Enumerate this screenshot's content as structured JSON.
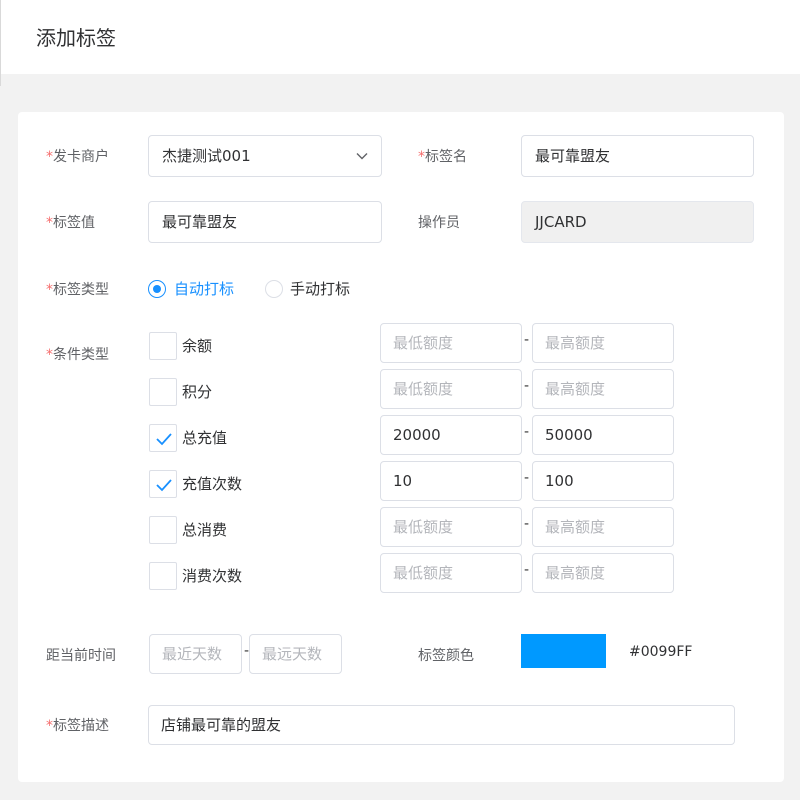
{
  "header": {
    "title": "添加标签"
  },
  "form": {
    "required_mark": "*",
    "merchant": {
      "label": "发卡商户",
      "value": "杰捷测试001"
    },
    "tag_name": {
      "label": "标签名",
      "value": "最可靠盟友"
    },
    "tag_value": {
      "label": "标签值",
      "value": "最可靠盟友"
    },
    "operator": {
      "label": "操作员",
      "value": "JJCARD"
    },
    "tag_type": {
      "label": "标签类型",
      "options": [
        {
          "label": "自动打标",
          "selected": true
        },
        {
          "label": "手动打标",
          "selected": false
        }
      ]
    },
    "conditions": {
      "label": "条件类型",
      "separator": "-",
      "items": [
        {
          "label": "余额",
          "checked": false,
          "min": "",
          "max": "",
          "min_placeholder": "最低额度",
          "max_placeholder": "最高额度"
        },
        {
          "label": "积分",
          "checked": false,
          "min": "",
          "max": "",
          "min_placeholder": "最低额度",
          "max_placeholder": "最高额度"
        },
        {
          "label": "总充值",
          "checked": true,
          "min": "20000",
          "max": "50000",
          "min_placeholder": "最低额度",
          "max_placeholder": "最高额度"
        },
        {
          "label": "充值次数",
          "checked": true,
          "min": "10",
          "max": "100",
          "min_placeholder": "最低额度",
          "max_placeholder": "最高额度"
        },
        {
          "label": "总消费",
          "checked": false,
          "min": "",
          "max": "",
          "min_placeholder": "最低额度",
          "max_placeholder": "最高额度"
        },
        {
          "label": "消费次数",
          "checked": false,
          "min": "",
          "max": "",
          "min_placeholder": "最低额度",
          "max_placeholder": "最高额度"
        }
      ]
    },
    "distance": {
      "label": "距当前时间",
      "separator": "-",
      "min_placeholder": "最近天数",
      "max_placeholder": "最远天数"
    },
    "tag_color": {
      "label": "标签颜色",
      "value": "#0099FF"
    },
    "description": {
      "label": "标签描述",
      "value": "店铺最可靠的盟友"
    }
  },
  "colors": {
    "accent": "#1890ff",
    "required": "#f56c6c",
    "swatch": "#0099FF"
  }
}
